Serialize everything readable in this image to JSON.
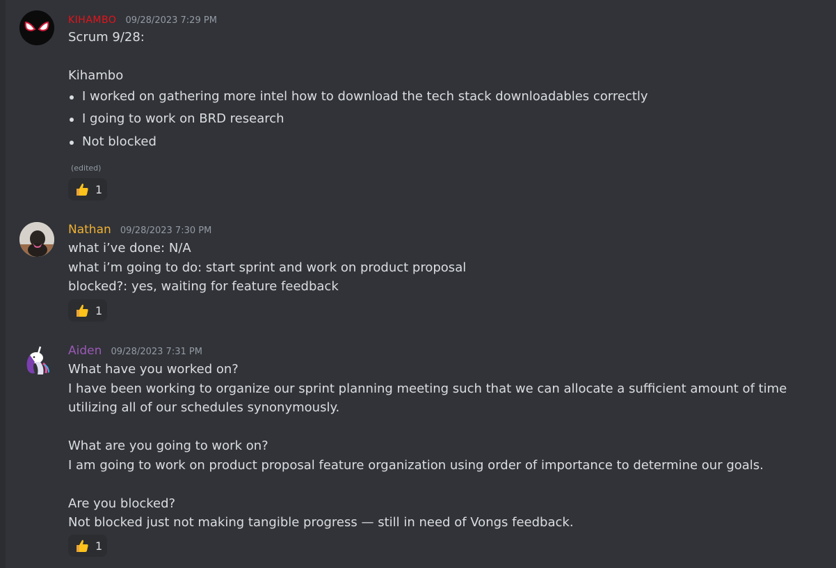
{
  "messages": [
    {
      "author": "KIHAMBO",
      "author_color": "#e5131b",
      "time": "09/28/2023 7:29 PM",
      "lines_top": [
        "Scrum 9/28:",
        "",
        "Kihambo"
      ],
      "bullets": [
        "I worked on gathering more intel how to download the tech stack downloadables correctly",
        "I going to work on BRD research",
        "Not blocked"
      ],
      "edited": "(edited)",
      "reaction": {
        "emoji": "thumbs-up-icon",
        "count": "1"
      }
    },
    {
      "author": "Nathan",
      "author_color": "#f0b132",
      "time": "09/28/2023 7:30 PM",
      "lines": [
        "what i’ve done: N/A",
        "what i’m going to do: start sprint and work on product proposal",
        "blocked?: yes, waiting for feature feedback"
      ],
      "reaction": {
        "emoji": "thumbs-up-icon",
        "count": "1"
      }
    },
    {
      "author": "Aiden",
      "author_color": "#9b59b6",
      "time": "09/28/2023 7:31 PM",
      "lines": [
        "What have you worked on?",
        "I have been working to organize our sprint planning meeting such that we can allocate a sufficient amount of time utilizing all of our schedules synonymously.",
        "",
        "What are you going to work on?",
        "I am going to work on product proposal feature organization using order of importance to determine our goals.",
        "",
        "Are you blocked?",
        "Not blocked just not making tangible progress — still in need of Vongs feedback."
      ],
      "reaction": {
        "emoji": "thumbs-up-icon",
        "count": "1"
      }
    }
  ]
}
